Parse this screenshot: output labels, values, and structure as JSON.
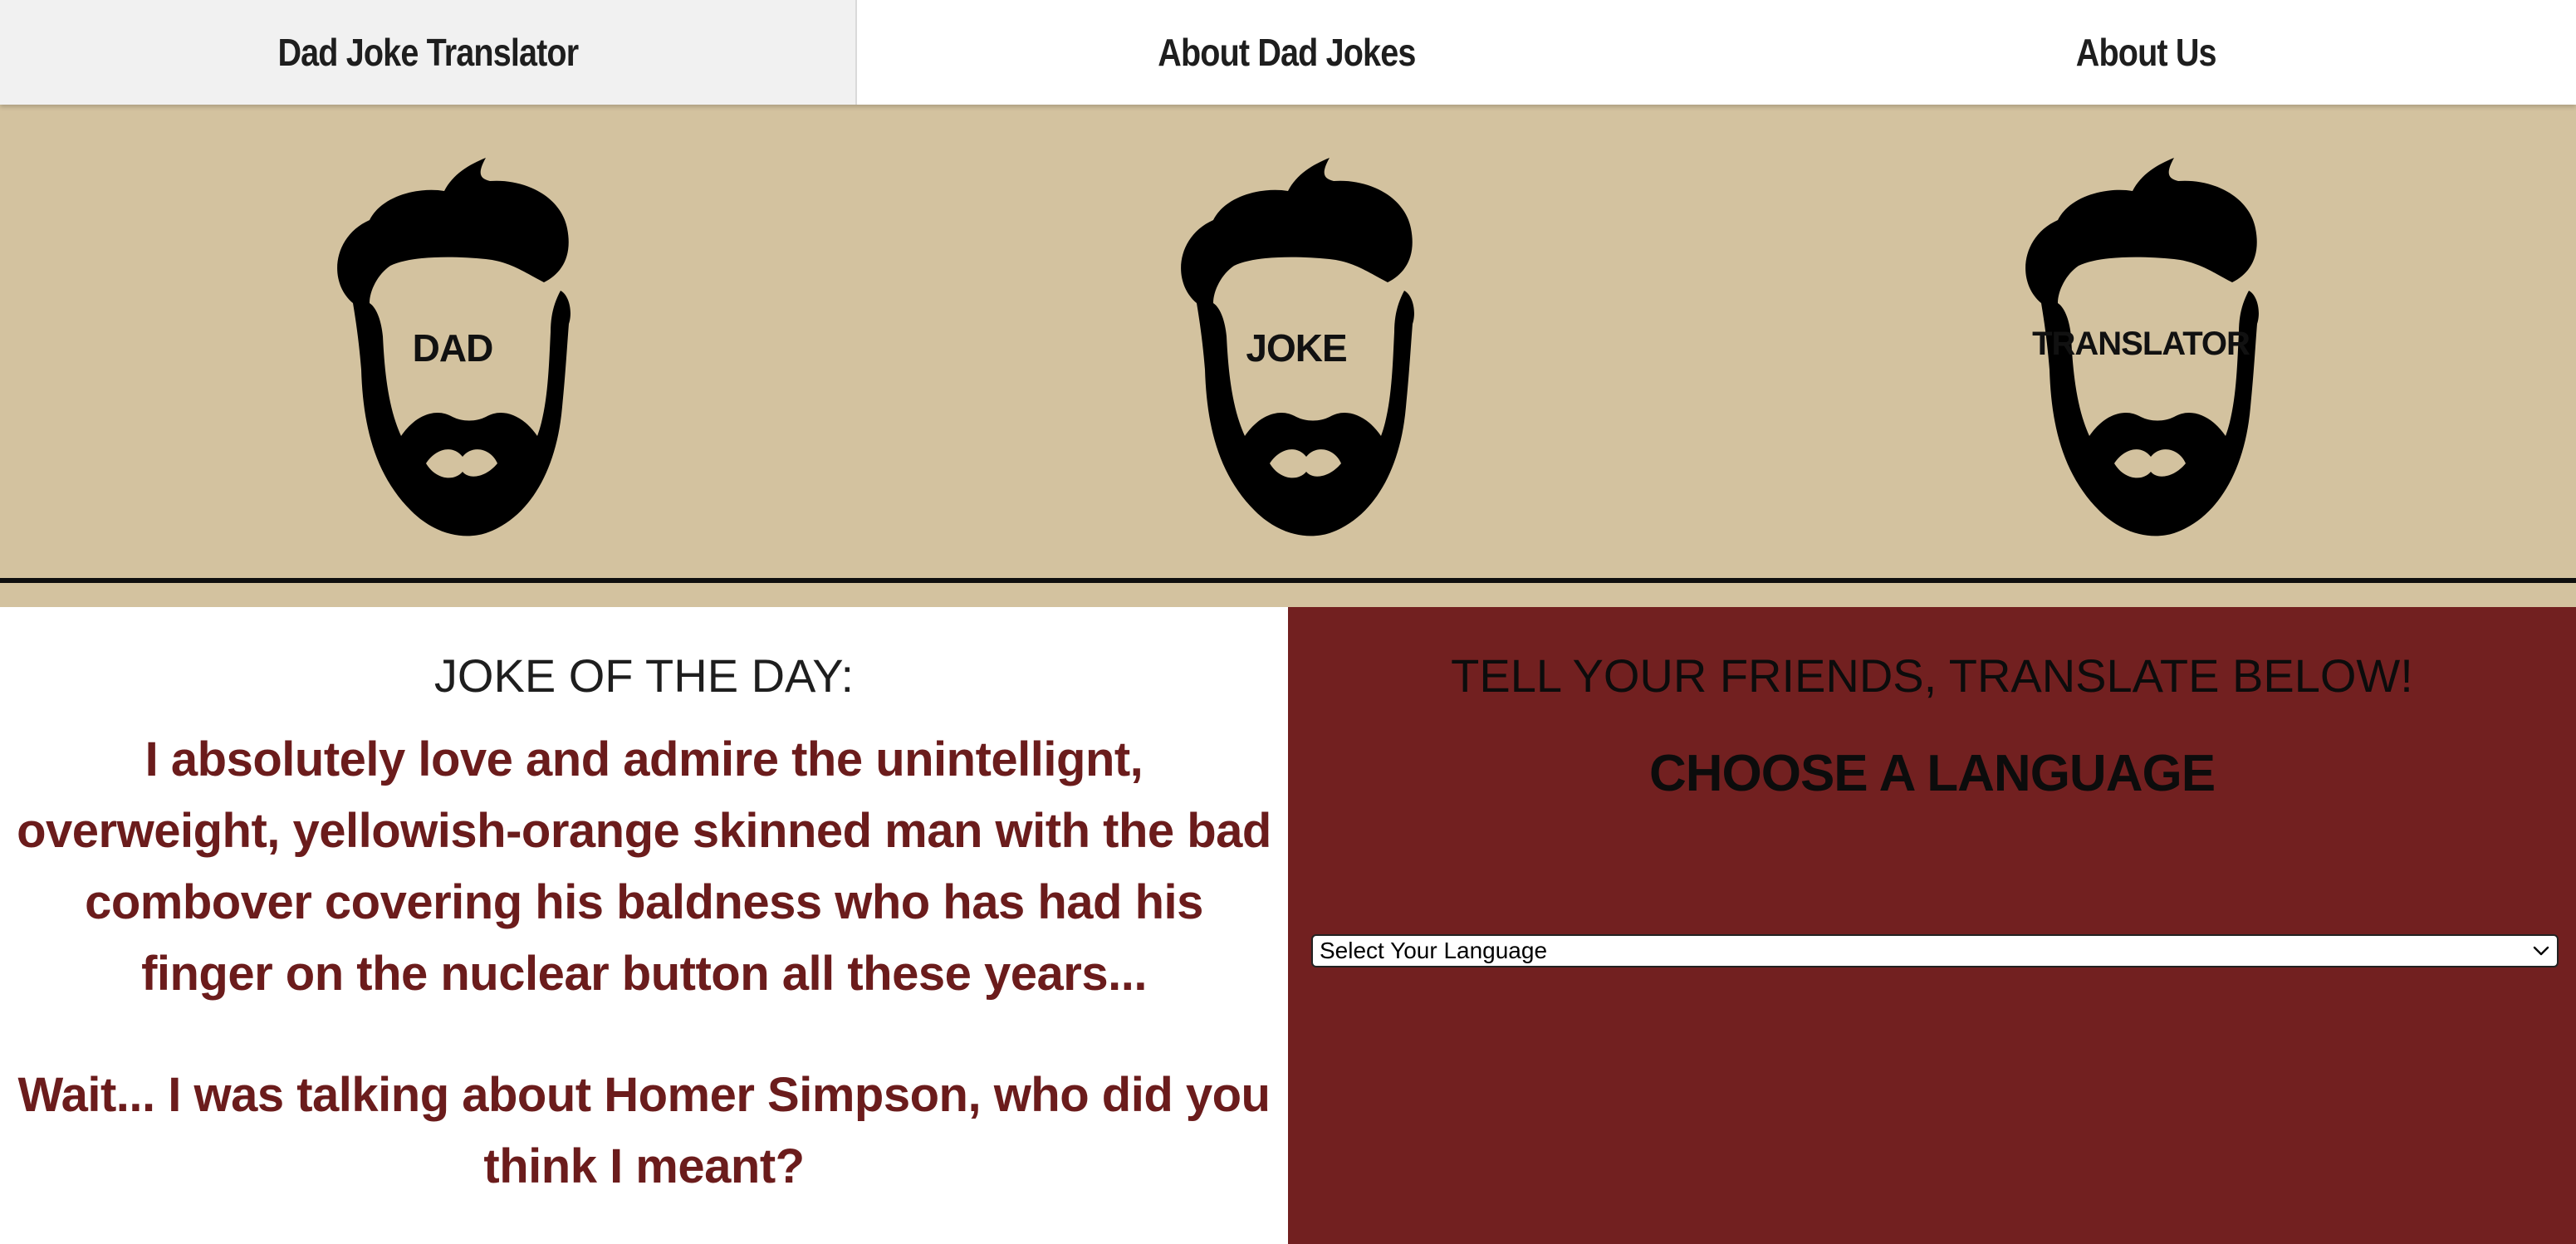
{
  "nav": {
    "items": [
      {
        "label": "Dad Joke Translator",
        "active": true
      },
      {
        "label": "About Dad Jokes",
        "active": false
      },
      {
        "label": "About Us",
        "active": false
      }
    ]
  },
  "banner": {
    "background": "#d3c29f",
    "heads": [
      {
        "label": "DAD",
        "icon": "bearded-man-head-icon"
      },
      {
        "label": "JOKE",
        "icon": "bearded-man-head-icon"
      },
      {
        "label": "TRANSLATOR",
        "icon": "bearded-man-head-icon"
      }
    ]
  },
  "joke_of_the_day": {
    "title": "JOKE OF THE DAY:",
    "setup": "I absolutely love and admire the unintellignt, overweight, yellowish-orange skinned man with the bad combover covering his baldness who has had his finger on the nuclear button all these years...",
    "punchline": "Wait... I was talking about Homer Simpson, who did you think I meant?"
  },
  "translate": {
    "title": "TELL YOUR FRIENDS, TRANSLATE BELOW!",
    "choose_label": "CHOOSE A LANGUAGE",
    "select": {
      "selected": "Select Your Language",
      "icon": "chevron-down-icon"
    }
  },
  "colors": {
    "accent_red": "#722020",
    "joke_text": "#6b1c1c",
    "banner_tan": "#d3c29f"
  }
}
